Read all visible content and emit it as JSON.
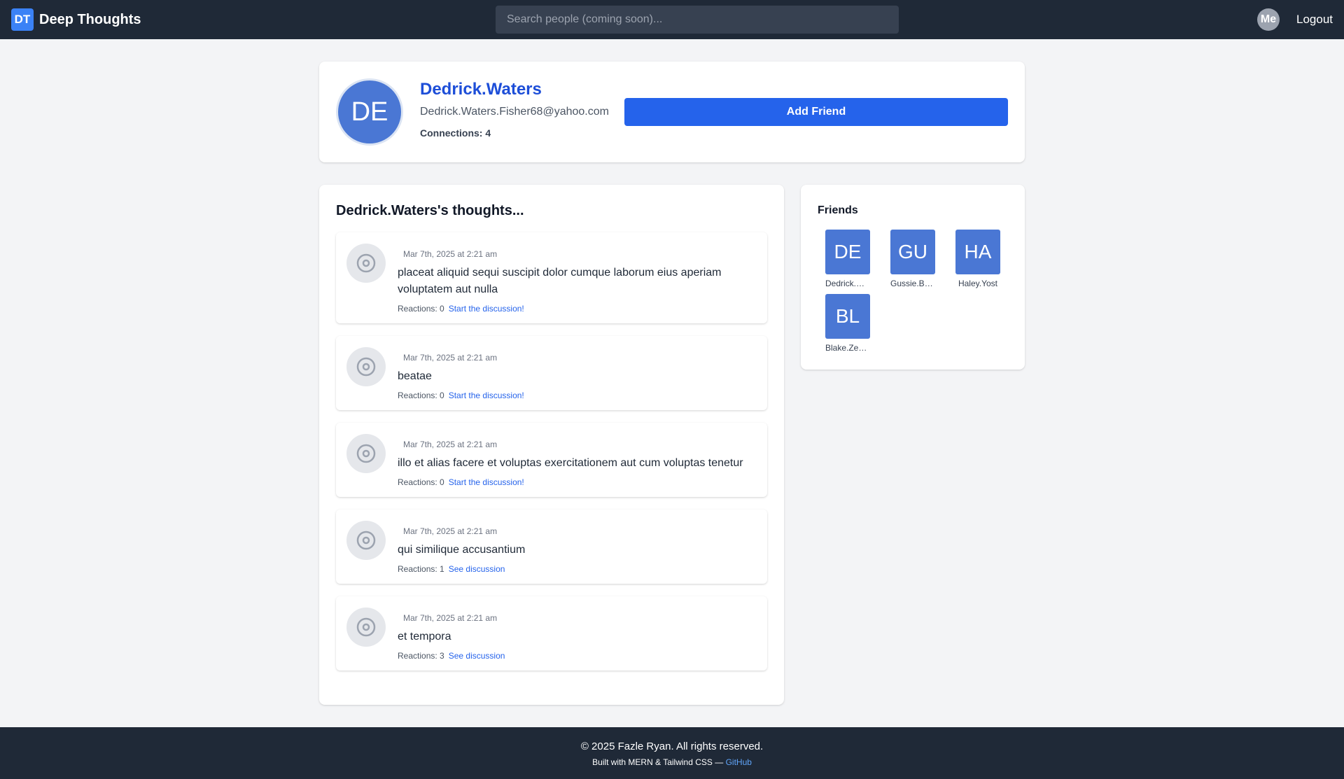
{
  "navbar": {
    "logo_text": "DT",
    "brand_name": "Deep Thoughts",
    "search_placeholder": "Search people (coming soon)...",
    "avatar_text": "Me",
    "logout_label": "Logout"
  },
  "profile": {
    "initials": "DE",
    "name": "Dedrick.Waters",
    "email": "Dedrick.Waters.Fisher68@yahoo.com",
    "connections": "Connections: 4",
    "add_friend_label": "Add Friend"
  },
  "thoughts": {
    "title": "Dedrick.Waters's thoughts...",
    "items": [
      {
        "date": "Mar 7th, 2025 at 2:21 am",
        "text": "placeat aliquid sequi suscipit dolor cumque laborum eius aperiam voluptatem aut nulla",
        "reactions": "Reactions: 0",
        "link": "Start the discussion!"
      },
      {
        "date": "Mar 7th, 2025 at 2:21 am",
        "text": "beatae",
        "reactions": "Reactions: 0",
        "link": "Start the discussion!"
      },
      {
        "date": "Mar 7th, 2025 at 2:21 am",
        "text": "illo et alias facere et voluptas exercitationem aut cum voluptas tenetur",
        "reactions": "Reactions: 0",
        "link": "Start the discussion!"
      },
      {
        "date": "Mar 7th, 2025 at 2:21 am",
        "text": "qui similique accusantium",
        "reactions": "Reactions: 1",
        "link": "See discussion"
      },
      {
        "date": "Mar 7th, 2025 at 2:21 am",
        "text": "et tempora",
        "reactions": "Reactions: 3",
        "link": "See discussion"
      }
    ]
  },
  "friends": {
    "title": "Friends",
    "items": [
      {
        "initials": "DE",
        "name": "Dedrick.W..."
      },
      {
        "initials": "GU",
        "name": "Gussie.Be..."
      },
      {
        "initials": "HA",
        "name": "Haley.Yost"
      },
      {
        "initials": "BL",
        "name": "Blake.Zem..."
      }
    ]
  },
  "footer": {
    "copyright": "© 2025 Fazle Ryan. All rights reserved.",
    "built_with": "Built with MERN & Tailwind CSS — ",
    "github_label": "GitHub"
  },
  "colors": {
    "navbar_bg": "#1f2937",
    "accent": "#2563eb",
    "avatar_bg": "#4a77d4"
  },
  "icons": {
    "thought_avatar": "target-icon"
  }
}
